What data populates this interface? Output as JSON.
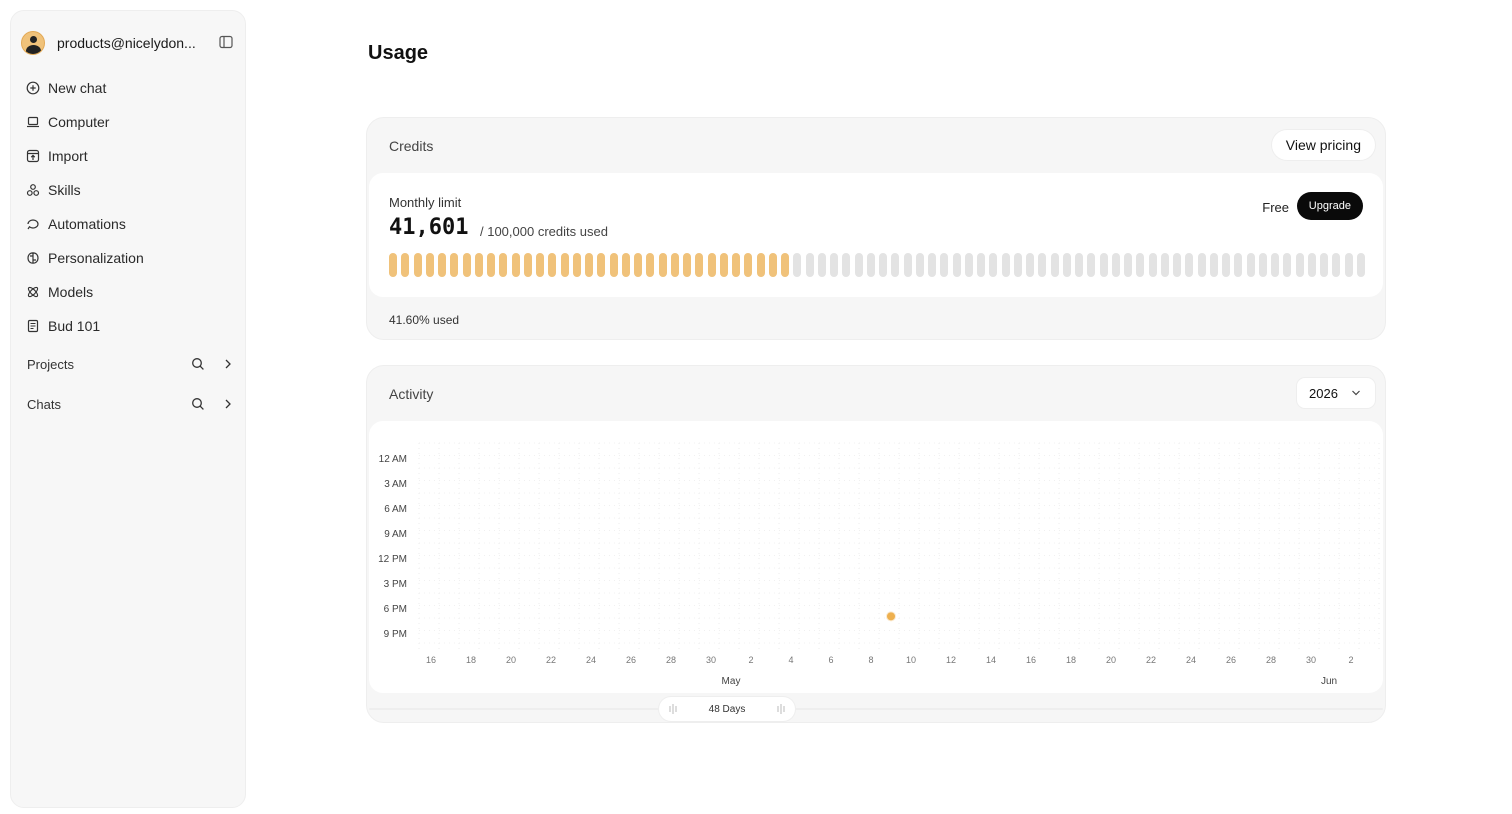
{
  "sidebar": {
    "account": "products@nicelydon...",
    "items": [
      {
        "label": "New chat",
        "icon": "plus-circle-icon"
      },
      {
        "label": "Computer",
        "icon": "laptop-icon"
      },
      {
        "label": "Import",
        "icon": "import-icon"
      },
      {
        "label": "Skills",
        "icon": "skills-icon"
      },
      {
        "label": "Automations",
        "icon": "automations-icon"
      },
      {
        "label": "Personalization",
        "icon": "brain-icon"
      },
      {
        "label": "Models",
        "icon": "atom-icon"
      },
      {
        "label": "Bud 101",
        "icon": "book-icon"
      }
    ],
    "sections": [
      {
        "label": "Projects"
      },
      {
        "label": "Chats"
      }
    ]
  },
  "page": {
    "title": "Usage"
  },
  "credits": {
    "header": "Credits",
    "view_pricing": "View pricing",
    "monthly_label": "Monthly limit",
    "used_value": "41,601",
    "used_suffix": "/ 100,000 credits used",
    "plan": "Free",
    "upgrade": "Upgrade",
    "used_fraction": 0.416,
    "segments_total": 80,
    "percent_label": "41.60% used"
  },
  "activity": {
    "header": "Activity",
    "year": "2026",
    "range_label": "48 Days",
    "accent": "#f0c27a",
    "chart_data": {
      "type": "scatter",
      "y_categories": [
        "12 AM",
        "3 AM",
        "6 AM",
        "9 AM",
        "12 PM",
        "3 PM",
        "6 PM",
        "9 PM"
      ],
      "x_ticks": [
        "16",
        "18",
        "20",
        "22",
        "24",
        "26",
        "28",
        "30",
        "2",
        "4",
        "6",
        "8",
        "10",
        "12",
        "14",
        "16",
        "18",
        "20",
        "22",
        "24",
        "26",
        "28",
        "30",
        "2"
      ],
      "month_labels": [
        {
          "label": "May",
          "tick_index": 7.5
        },
        {
          "label": "Jun",
          "tick_index": 23
        }
      ],
      "points": [
        {
          "day_index": 23,
          "hour": 19
        }
      ]
    }
  }
}
